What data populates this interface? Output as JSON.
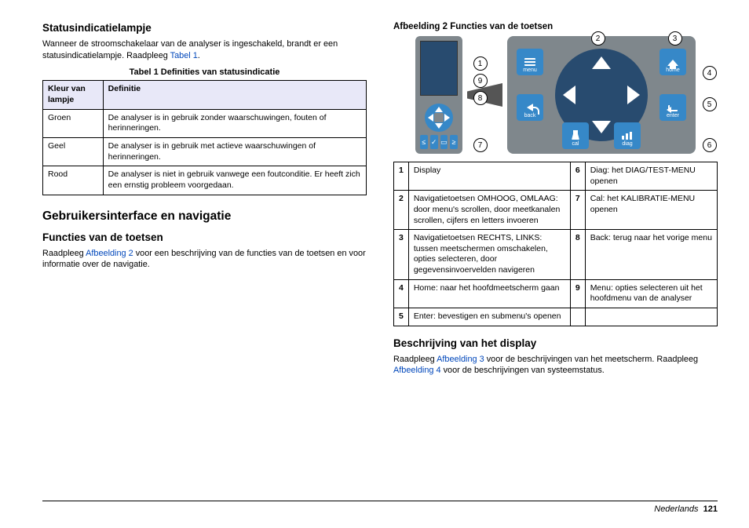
{
  "left": {
    "h1": "Statusindicatielampje",
    "p1a": "Wanneer de stroomschakelaar van de analyser is ingeschakeld, brandt er een statusindicatielampje. Raadpleeg ",
    "p1link": "Tabel 1",
    "p1b": ".",
    "table1_caption": "Tabel 1  Definities van statusindicatie",
    "th1": "Kleur van lampje",
    "th2": "Definitie",
    "r1a": "Groen",
    "r1b": "De analyser is in gebruik zonder waarschuwingen, fouten of herinneringen.",
    "r2a": "Geel",
    "r2b": "De analyser is in gebruik met actieve waarschuwingen of herinneringen.",
    "r3a": "Rood",
    "r3b": "De analyser is niet in gebruik vanwege een foutconditie. Er heeft zich een ernstig probleem voorgedaan.",
    "h2": "Gebruikersinterface en navigatie",
    "h3": "Functies van de toetsen",
    "p2a": "Raadpleeg ",
    "p2link": "Afbeelding 2",
    "p2b": " voor een beschrijving van de functies van de toetsen en voor informatie over de navigatie."
  },
  "right": {
    "fig_caption": "Afbeelding 2  Functies van de toetsen",
    "keys": {
      "menu": "menu",
      "home": "home",
      "back": "back",
      "enter": "enter",
      "cal": "cal",
      "diag": "diag"
    },
    "callouts": {
      "1": "1",
      "2": "2",
      "3": "3",
      "4": "4",
      "5": "5",
      "6": "6",
      "7": "7",
      "8": "8",
      "9": "9"
    },
    "legend": {
      "1": "Display",
      "2": "Navigatietoetsen OMHOOG, OMLAAG: door menu's scrollen, door meetkanalen scrollen, cijfers en letters invoeren",
      "3": "Navigatietoetsen RECHTS, LINKS: tussen meetschermen omschakelen, opties selecteren, door gegevensinvoervelden navigeren",
      "4": "Home: naar het hoofdmeetscherm gaan",
      "5": "Enter: bevestigen en submenu's openen",
      "6": "Diag: het DIAG/TEST-MENU openen",
      "7": "Cal: het KALIBRATIE-MENU openen",
      "8": "Back: terug naar het vorige menu",
      "9": "Menu: opties selecteren uit het hoofdmenu van de analyser"
    },
    "h4": "Beschrijving van het display",
    "p3a": "Raadpleeg ",
    "p3link1": "Afbeelding 3",
    "p3b": " voor de beschrijvingen van het meetscherm. Raadpleeg ",
    "p3link2": "Afbeelding 4",
    "p3c": " voor de beschrijvingen van systeemstatus."
  },
  "footer": {
    "lang": "Nederlands",
    "page": "121"
  }
}
